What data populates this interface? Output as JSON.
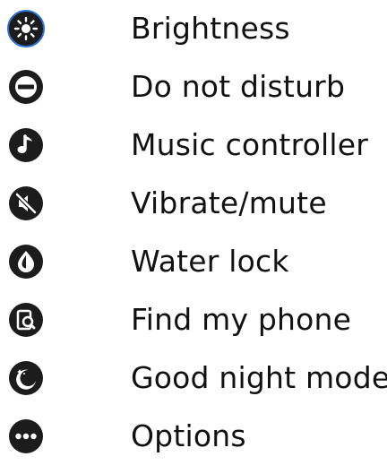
{
  "icon_color": "#1c1c1c",
  "accent_color": "#2f6fd6",
  "items": [
    {
      "icon": "brightness-icon",
      "label": "Brightness"
    },
    {
      "icon": "do-not-disturb-icon",
      "label": "Do not disturb"
    },
    {
      "icon": "music-note-icon",
      "label": "Music controller"
    },
    {
      "icon": "vibrate-mute-icon",
      "label": "Vibrate/mute"
    },
    {
      "icon": "water-drop-icon",
      "label": "Water lock"
    },
    {
      "icon": "find-phone-icon",
      "label": "Find my phone"
    },
    {
      "icon": "moon-stars-icon",
      "label": "Good night mode"
    },
    {
      "icon": "more-options-icon",
      "label": "Options"
    }
  ]
}
